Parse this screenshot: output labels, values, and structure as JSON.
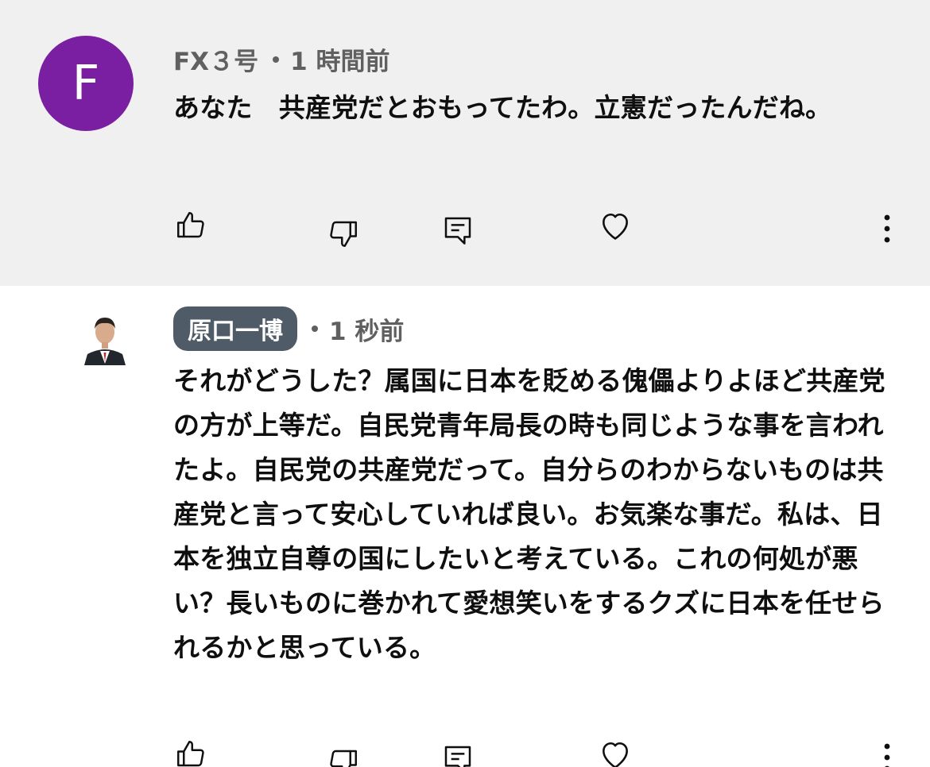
{
  "comments": [
    {
      "avatar_letter": "F",
      "avatar_color": "#7b1fa2",
      "author": "FX３号",
      "time": "1 時間前",
      "text": "あなた　共産党だとおもってたわ。立憲だったんだね。",
      "highlighted": true
    },
    {
      "author": "原口一博",
      "time": "1 秒前",
      "text": "それがどうした？属国に日本を貶める傀儡よりよほど共産党の方が上等だ。自民党青年局長の時も同じような事を言われたよ。自民党の共産党だって。自分らのわからないものは共産党と言って安心していれば良い。お気楽な事だ。私は、日本を独立自尊の国にしたいと考えている。これの何処が悪い？長いものに巻かれて愛想笑いをするクズに日本を任せられるかと思っている。",
      "highlighted": false
    }
  ],
  "actions": {
    "like_icon": "thumbs-up-icon",
    "dislike_icon": "thumbs-down-icon",
    "reply_icon": "reply-comment-icon",
    "heart_icon": "heart-icon",
    "more_icon": "more-vertical-icon"
  }
}
